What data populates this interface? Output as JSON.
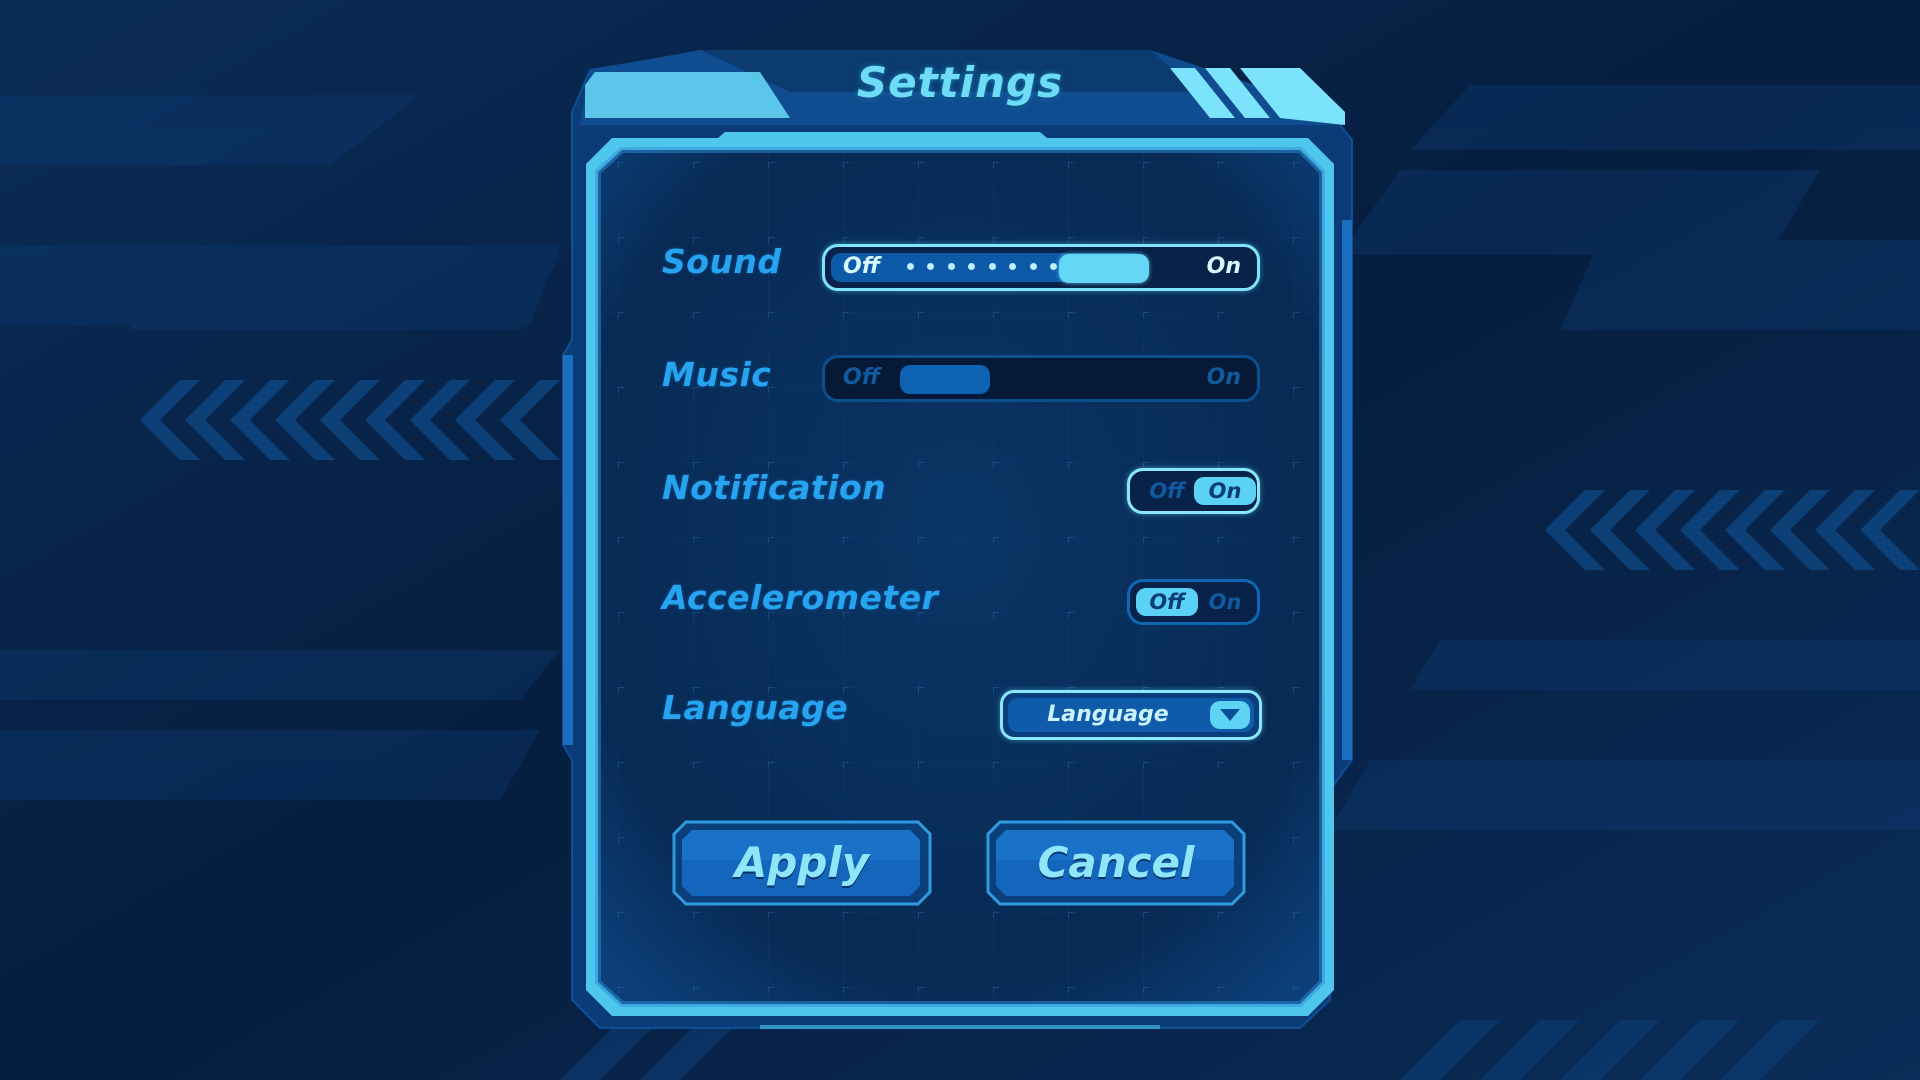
{
  "title": "Settings",
  "settings": {
    "sound": {
      "label": "Sound",
      "off": "Off",
      "on": "On",
      "level": 0.63
    },
    "music": {
      "label": "Music",
      "off": "Off",
      "on": "On",
      "level": 0.05
    },
    "notification": {
      "label": "Notification",
      "off": "Off",
      "on": "On",
      "state": "On"
    },
    "accelerometer": {
      "label": "Accelerometer",
      "off": "Off",
      "on": "On",
      "state": "Off"
    },
    "language": {
      "label": "Language",
      "value": "Language"
    }
  },
  "buttons": {
    "apply": "Apply",
    "cancel": "Cancel"
  },
  "icons": {
    "dropdown": "chevron-down-icon"
  },
  "colors": {
    "accent": "#6fdcf7",
    "label": "#27a4ef",
    "background": "#061a33"
  }
}
